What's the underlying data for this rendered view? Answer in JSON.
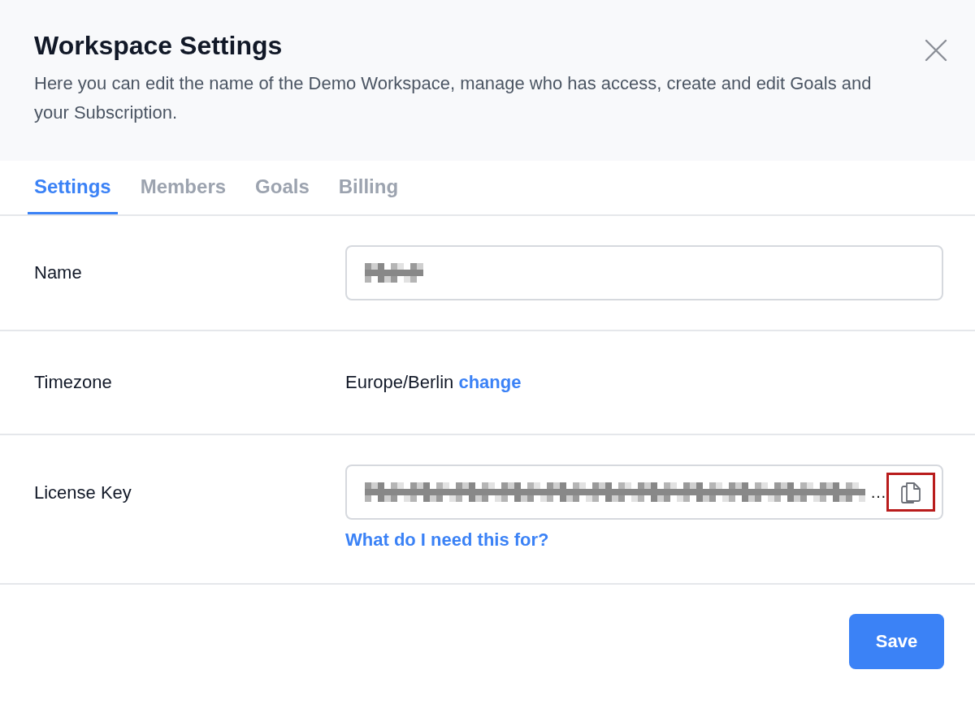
{
  "header": {
    "title": "Workspace Settings",
    "description": "Here you can edit the name of the Demo Workspace, manage who has access, create and edit Goals and your Subscription."
  },
  "tabs": [
    {
      "label": "Settings",
      "selected": true
    },
    {
      "label": "Members",
      "selected": false
    },
    {
      "label": "Goals",
      "selected": false
    },
    {
      "label": "Billing",
      "selected": false
    }
  ],
  "rows": [
    {
      "kind": "input",
      "label": "Name",
      "obscured": true
    },
    {
      "kind": "text",
      "label": "Timezone",
      "value": "Europe/Berlin",
      "link": "change"
    },
    {
      "kind": "key",
      "label": "License Key",
      "obscured": true,
      "ellipsis": "…",
      "copy_highlighted": true,
      "help_link": "What do I need this for?"
    }
  ],
  "footer": {
    "save": "Save"
  }
}
